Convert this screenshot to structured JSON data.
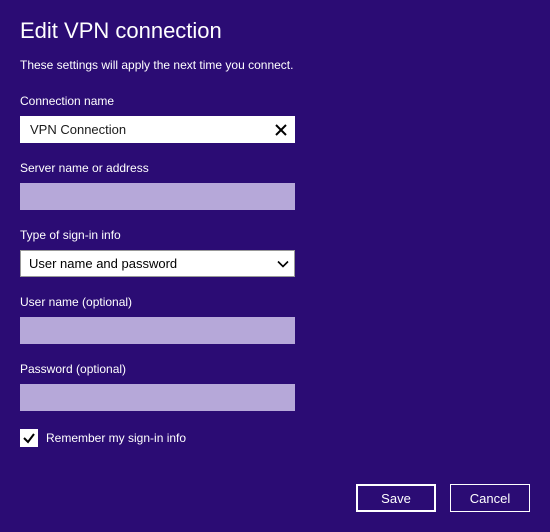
{
  "title": "Edit VPN connection",
  "subtitle": "These settings will apply the next time you connect.",
  "fields": {
    "connection_name": {
      "label": "Connection name",
      "value": "VPN Connection"
    },
    "server": {
      "label": "Server name or address",
      "value": ""
    },
    "signin_type": {
      "label": "Type of sign-in info",
      "value": "User name and password"
    },
    "username": {
      "label": "User name (optional)",
      "value": ""
    },
    "password": {
      "label": "Password (optional)",
      "value": ""
    }
  },
  "remember": {
    "label": "Remember my sign-in info",
    "checked": true
  },
  "buttons": {
    "save": "Save",
    "cancel": "Cancel"
  }
}
